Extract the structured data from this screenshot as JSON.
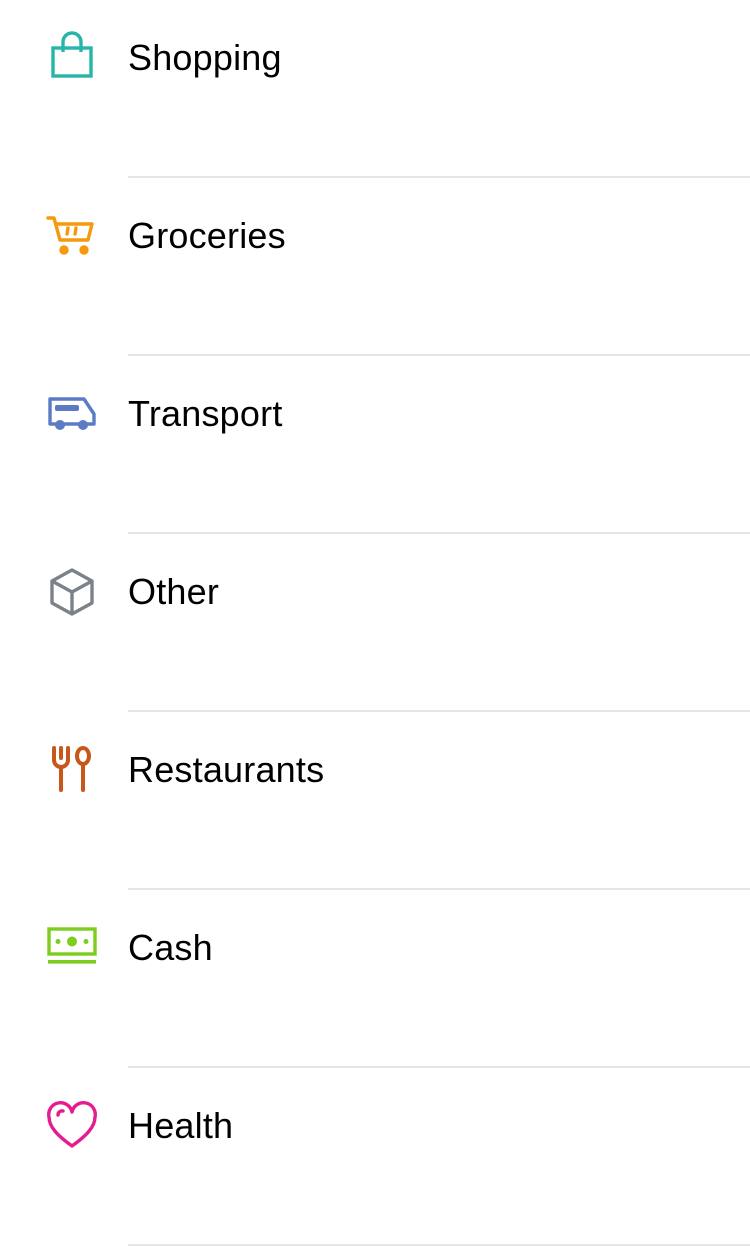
{
  "categories": [
    {
      "label": "Shopping",
      "icon": "shopping-bag-icon",
      "color": "#26b5a8"
    },
    {
      "label": "Groceries",
      "icon": "shopping-cart-icon",
      "color": "#f59a0c"
    },
    {
      "label": "Transport",
      "icon": "bus-icon",
      "color": "#5b7bc4"
    },
    {
      "label": "Other",
      "icon": "box-icon",
      "color": "#7a838c"
    },
    {
      "label": "Restaurants",
      "icon": "fork-spoon-icon",
      "color": "#c8571a"
    },
    {
      "label": "Cash",
      "icon": "banknote-icon",
      "color": "#7ccd1e"
    },
    {
      "label": "Health",
      "icon": "heart-icon",
      "color": "#e51c8f"
    }
  ]
}
